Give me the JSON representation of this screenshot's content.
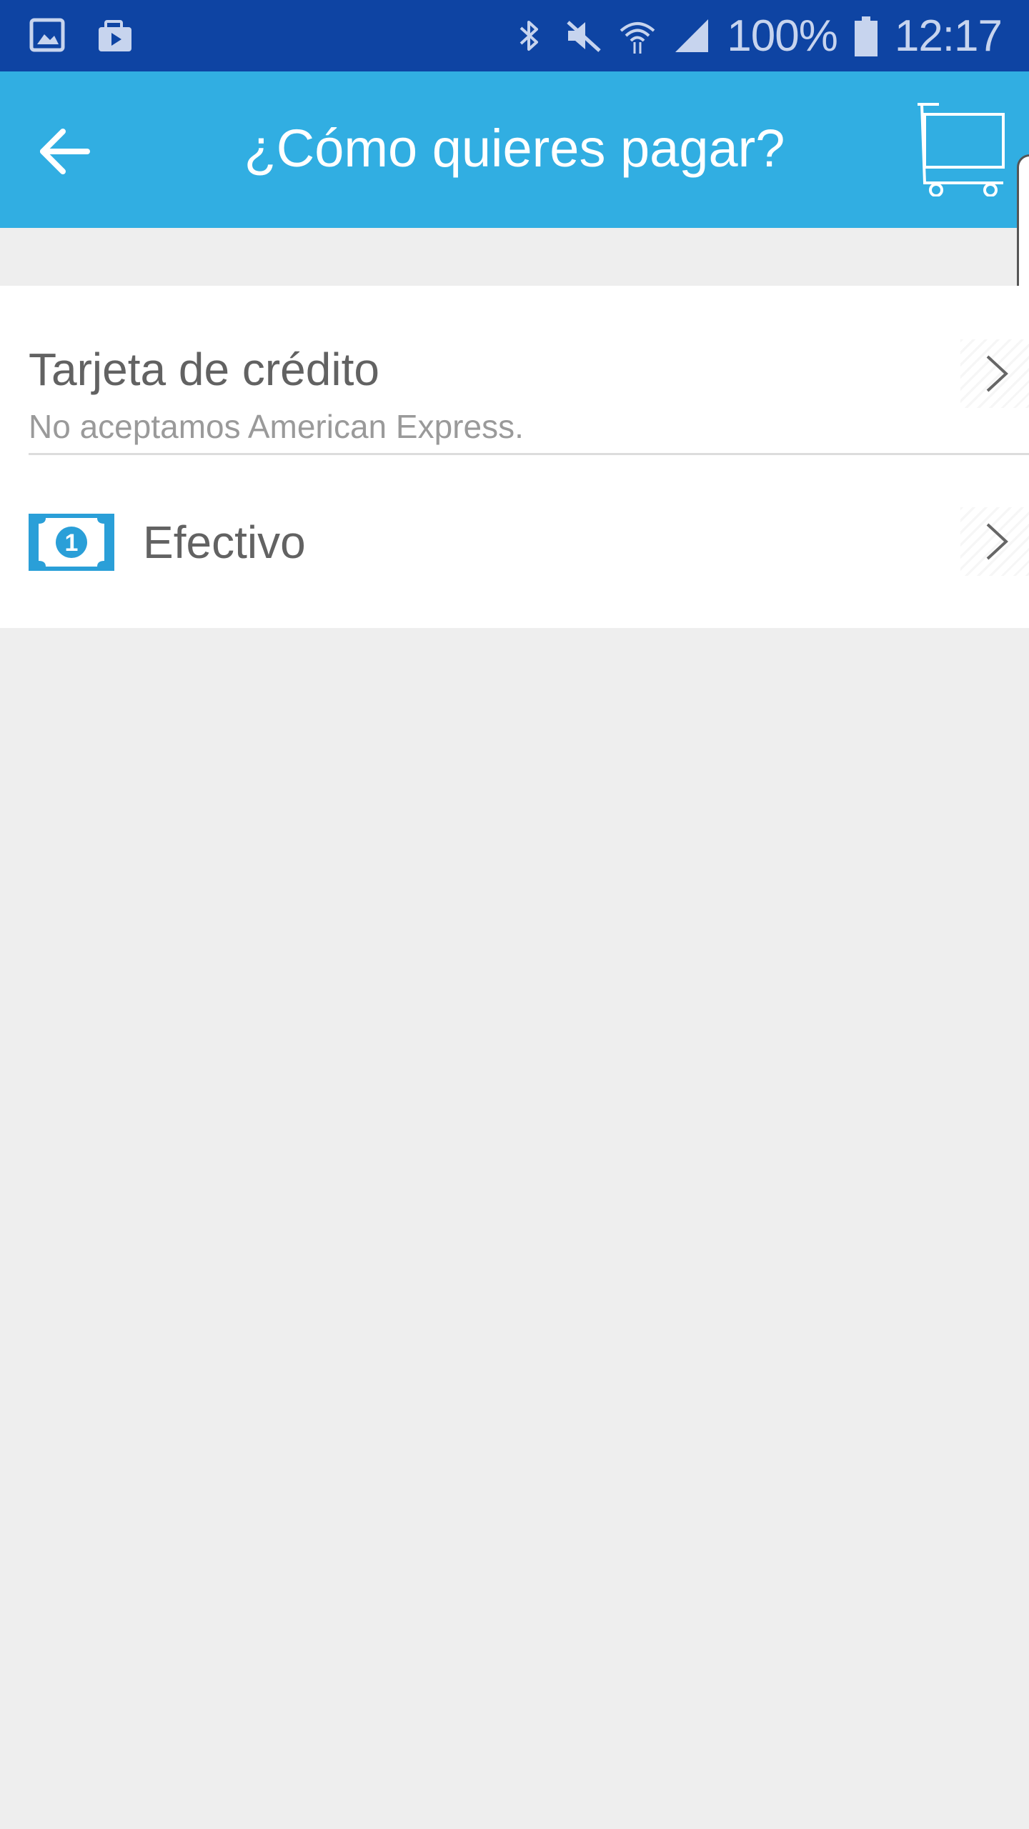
{
  "status_bar": {
    "battery_text": "100%",
    "time": "12:17",
    "icons": [
      "gallery-icon",
      "briefcase-play-icon",
      "bluetooth-icon",
      "mute-icon",
      "wifi-icon",
      "signal-icon",
      "battery-icon"
    ]
  },
  "header": {
    "title": "¿Cómo quieres pagar?",
    "back_icon": "arrow-left-icon",
    "cart_icon": "cart-icon"
  },
  "payment_options": [
    {
      "title": "Tarjeta de crédito",
      "subtitle": "No aceptamos American Express."
    },
    {
      "title": "Efectivo",
      "icon": "cash-bill-icon"
    }
  ],
  "colors": {
    "status_bar": "#0e44a3",
    "app_bar": "#31aee2",
    "background": "#eeeeee",
    "row_text": "#626262",
    "subtitle_text": "#9a9a9a"
  }
}
